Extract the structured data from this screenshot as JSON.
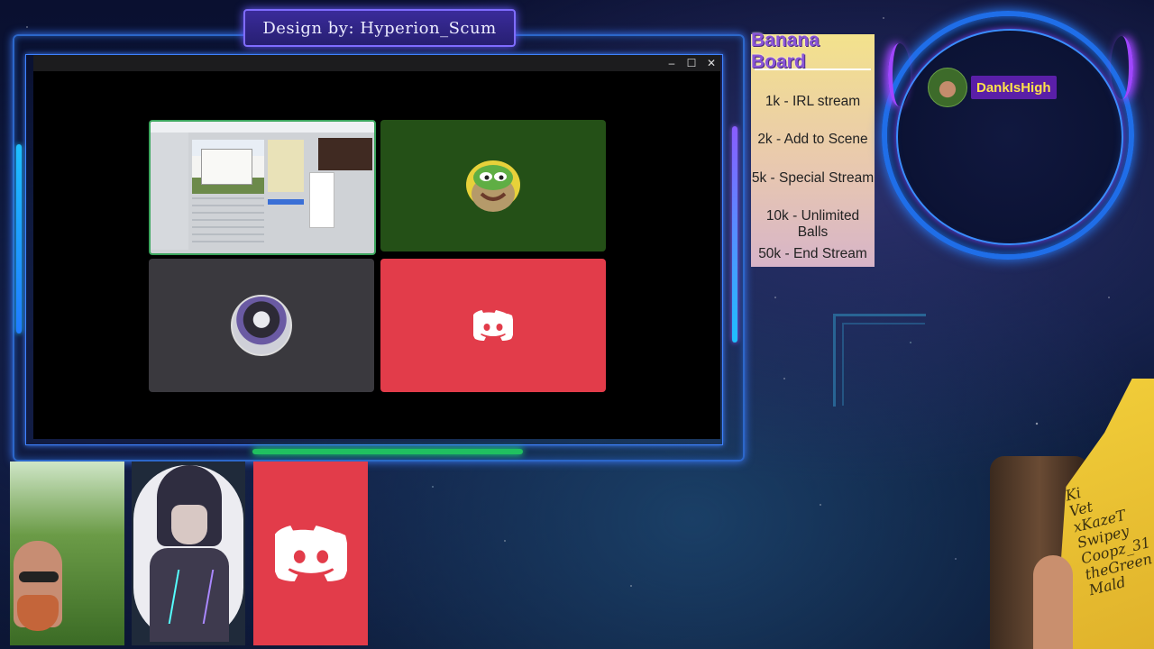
{
  "banner": {
    "text": "Design by: Hyperion_Scum"
  },
  "window": {
    "controls": {
      "minimize": "–",
      "maximize": "☐",
      "close": "✕"
    }
  },
  "banana_board": {
    "title": "Banana Board",
    "items": [
      "1k - IRL stream",
      "2k - Add to Scene",
      "5k - Special Stream",
      "10k - Unlimited Balls",
      "50k - End Stream"
    ]
  },
  "chat": {
    "username": "DankIsHigh"
  },
  "shirt_text": [
    "Ki",
    "Vet",
    "xKazeT",
    "Swipey",
    "Coopz_31",
    "theGreen",
    "Mald"
  ],
  "colors": {
    "discord": "#e23c4a",
    "speaking_border": "#3ba55d",
    "pepe_tile": "#245017",
    "avatar_tile": "#3a393e",
    "frame": "#2c67c9"
  },
  "icons": {
    "discord": "discord-logo-icon",
    "pepe": "pepe-emoji-icon"
  }
}
